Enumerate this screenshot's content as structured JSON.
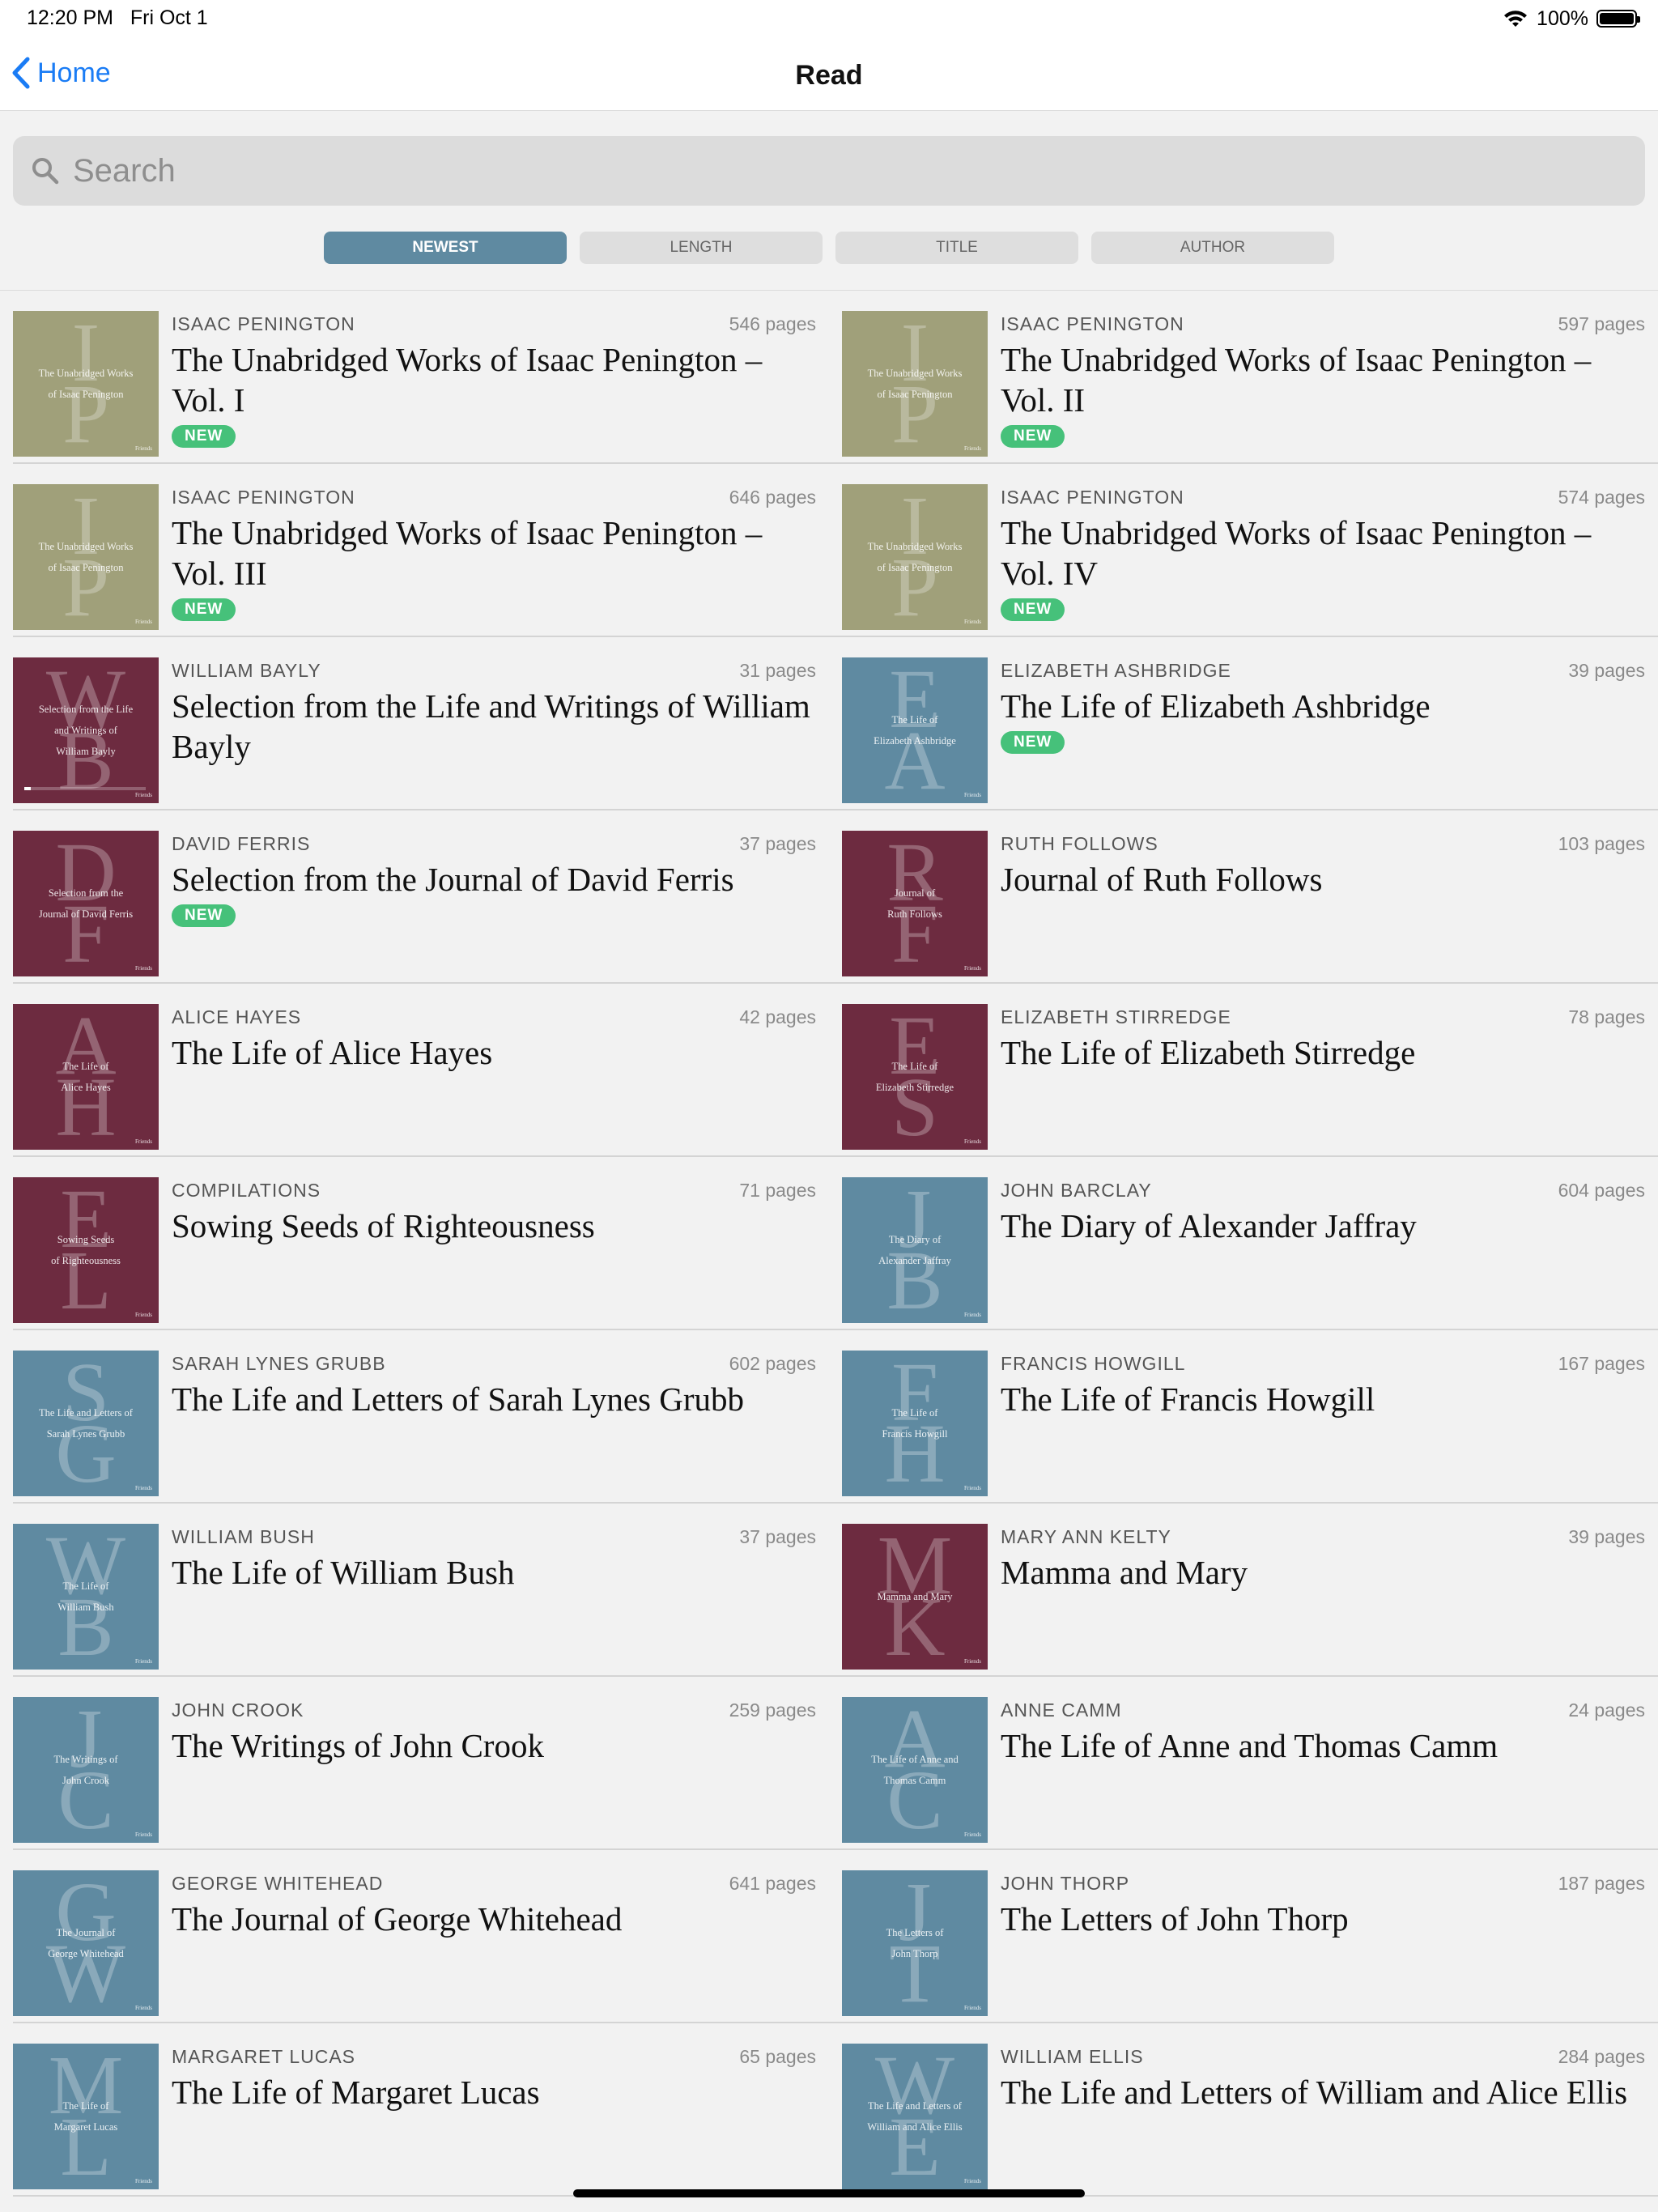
{
  "status_bar": {
    "time": "12:20 PM",
    "date": "Fri Oct 1",
    "battery": "100%"
  },
  "nav": {
    "back_label": "Home",
    "title": "Read"
  },
  "search": {
    "placeholder": "Search",
    "value": ""
  },
  "sort_tabs": [
    {
      "label": "NEWEST",
      "active": true
    },
    {
      "label": "LENGTH",
      "active": false
    },
    {
      "label": "TITLE",
      "active": false
    },
    {
      "label": "AUTHOR",
      "active": false
    }
  ],
  "colors": {
    "olive": "#a0a07a",
    "maroon": "#6d2b40",
    "blue": "#5f8aa1",
    "new_badge": "#46c17a",
    "link": "#1a7cf5"
  },
  "cover_publisher": "Friends",
  "new_label": "NEW",
  "books": [
    {
      "author": "ISAAC PENINGTON",
      "pages": "546 pages",
      "title": "The Unabridged Works of Isaac Penington – Vol. I",
      "is_new": true,
      "cover": {
        "color": "olive",
        "letters": [
          "I",
          "P"
        ],
        "lines": [
          "The Unabridged Works",
          "of Isaac Penington"
        ]
      }
    },
    {
      "author": "ISAAC PENINGTON",
      "pages": "597 pages",
      "title": "The Unabridged Works of Isaac Penington – Vol. II",
      "is_new": true,
      "cover": {
        "color": "olive",
        "letters": [
          "I",
          "P"
        ],
        "lines": [
          "The Unabridged Works",
          "of Isaac Penington"
        ]
      }
    },
    {
      "author": "ISAAC PENINGTON",
      "pages": "646 pages",
      "title": "The Unabridged Works of Isaac Penington – Vol. III",
      "is_new": true,
      "cover": {
        "color": "olive",
        "letters": [
          "I",
          "P"
        ],
        "lines": [
          "The Unabridged Works",
          "of Isaac Penington"
        ]
      }
    },
    {
      "author": "ISAAC PENINGTON",
      "pages": "574 pages",
      "title": "The Unabridged Works of Isaac Penington – Vol. IV",
      "is_new": true,
      "cover": {
        "color": "olive",
        "letters": [
          "I",
          "P"
        ],
        "lines": [
          "The Unabridged Works",
          "of Isaac Penington"
        ]
      }
    },
    {
      "author": "WILLIAM BAYLY",
      "pages": "31 pages",
      "title": "Selection from the Life and Writings of William Bayly",
      "is_new": false,
      "progress": 0.05,
      "cover": {
        "color": "maroon",
        "letters": [
          "W",
          "B"
        ],
        "lines": [
          "Selection from the Life",
          "and Writings of",
          "William Bayly"
        ]
      }
    },
    {
      "author": "ELIZABETH ASHBRIDGE",
      "pages": "39 pages",
      "title": "The Life of Elizabeth Ashbridge",
      "is_new": true,
      "cover": {
        "color": "blue",
        "letters": [
          "E",
          "A"
        ],
        "lines": [
          "The Life of",
          "Elizabeth Ashbridge"
        ]
      }
    },
    {
      "author": "DAVID FERRIS",
      "pages": "37 pages",
      "title": "Selection from the Journal of David Ferris",
      "is_new": true,
      "cover": {
        "color": "maroon",
        "letters": [
          "D",
          "F"
        ],
        "lines": [
          "Selection from the",
          "Journal of David Ferris"
        ]
      }
    },
    {
      "author": "RUTH FOLLOWS",
      "pages": "103 pages",
      "title": "Journal of Ruth Follows",
      "is_new": false,
      "cover": {
        "color": "maroon",
        "letters": [
          "R",
          "F"
        ],
        "lines": [
          "Journal of",
          "Ruth Follows"
        ]
      }
    },
    {
      "author": "ALICE HAYES",
      "pages": "42 pages",
      "title": "The Life of Alice Hayes",
      "is_new": false,
      "cover": {
        "color": "maroon",
        "letters": [
          "A",
          "H"
        ],
        "lines": [
          "The Life of",
          "Alice Hayes"
        ]
      }
    },
    {
      "author": "ELIZABETH STIRREDGE",
      "pages": "78 pages",
      "title": "The Life of Elizabeth Stirredge",
      "is_new": false,
      "cover": {
        "color": "maroon",
        "letters": [
          "E",
          "S"
        ],
        "lines": [
          "The Life of",
          "Elizabeth Stirredge"
        ]
      }
    },
    {
      "author": "COMPILATIONS",
      "pages": "71 pages",
      "title": "Sowing Seeds of Righteousness",
      "is_new": false,
      "cover": {
        "color": "maroon",
        "letters": [
          "E",
          "L"
        ],
        "lines": [
          "Sowing Seeds",
          "of Righteousness"
        ]
      }
    },
    {
      "author": "JOHN BARCLAY",
      "pages": "604 pages",
      "title": "The Diary of Alexander Jaffray",
      "is_new": false,
      "cover": {
        "color": "blue",
        "letters": [
          "J",
          "B"
        ],
        "lines": [
          "The Diary of",
          "Alexander Jaffray"
        ]
      }
    },
    {
      "author": "SARAH LYNES GRUBB",
      "pages": "602 pages",
      "title": "The Life and Letters of Sarah Lynes Grubb",
      "is_new": false,
      "cover": {
        "color": "blue",
        "letters": [
          "S",
          "G"
        ],
        "lines": [
          "The Life and Letters of",
          "Sarah Lynes Grubb"
        ]
      }
    },
    {
      "author": "FRANCIS HOWGILL",
      "pages": "167 pages",
      "title": "The Life of Francis Howgill",
      "is_new": false,
      "cover": {
        "color": "blue",
        "letters": [
          "F",
          "H"
        ],
        "lines": [
          "The Life of",
          "Francis Howgill"
        ]
      }
    },
    {
      "author": "WILLIAM BUSH",
      "pages": "37 pages",
      "title": "The Life of William Bush",
      "is_new": false,
      "cover": {
        "color": "blue",
        "letters": [
          "W",
          "B"
        ],
        "lines": [
          "The Life of",
          "William Bush"
        ]
      }
    },
    {
      "author": "MARY ANN KELTY",
      "pages": "39 pages",
      "title": "Mamma and Mary",
      "is_new": false,
      "cover": {
        "color": "maroon",
        "letters": [
          "M",
          "K"
        ],
        "lines": [
          "Mamma and Mary"
        ]
      }
    },
    {
      "author": "JOHN CROOK",
      "pages": "259 pages",
      "title": "The Writings of John Crook",
      "is_new": false,
      "cover": {
        "color": "blue",
        "letters": [
          "J",
          "C"
        ],
        "lines": [
          "The Writings of",
          "John Crook"
        ]
      }
    },
    {
      "author": "ANNE CAMM",
      "pages": "24 pages",
      "title": "The Life of Anne and Thomas Camm",
      "is_new": false,
      "cover": {
        "color": "blue",
        "letters": [
          "A",
          "C"
        ],
        "lines": [
          "The Life of Anne and",
          "Thomas Camm"
        ]
      }
    },
    {
      "author": "GEORGE WHITEHEAD",
      "pages": "641 pages",
      "title": "The Journal of George Whitehead",
      "is_new": false,
      "cover": {
        "color": "blue",
        "letters": [
          "G",
          "W"
        ],
        "lines": [
          "The Journal of",
          "George Whitehead"
        ]
      }
    },
    {
      "author": "JOHN THORP",
      "pages": "187 pages",
      "title": "The Letters of John Thorp",
      "is_new": false,
      "cover": {
        "color": "blue",
        "letters": [
          "J",
          "T"
        ],
        "lines": [
          "The Letters of",
          "John Thorp"
        ]
      }
    },
    {
      "author": "MARGARET LUCAS",
      "pages": "65 pages",
      "title": "The Life of Margaret Lucas",
      "is_new": false,
      "cover": {
        "color": "blue",
        "letters": [
          "M",
          "L"
        ],
        "lines": [
          "The Life of",
          "Margaret Lucas"
        ]
      }
    },
    {
      "author": "WILLIAM ELLIS",
      "pages": "284 pages",
      "title": "The Life and Letters of William and Alice Ellis",
      "is_new": false,
      "cover": {
        "color": "blue",
        "letters": [
          "W",
          "E"
        ],
        "lines": [
          "The Life and Letters of",
          "William and Alice Ellis"
        ]
      }
    }
  ]
}
